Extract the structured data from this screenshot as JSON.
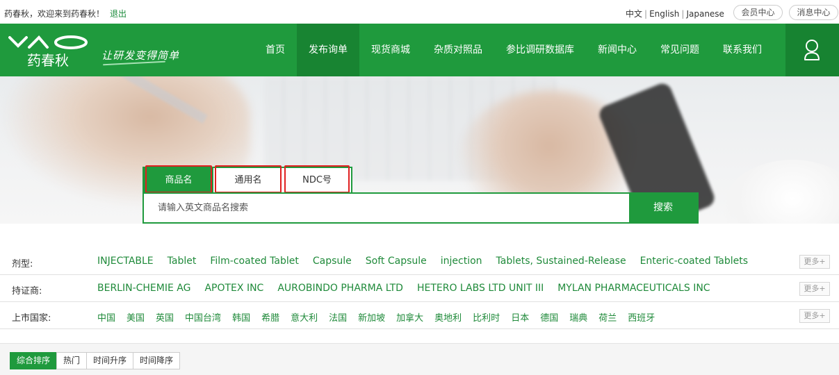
{
  "topbar": {
    "welcome": "药春秋，欢迎来到药春秋！",
    "logout": "退出",
    "languages": [
      "中文",
      "English",
      "Japanese"
    ],
    "member_center": "会员中心",
    "message_center": "消息中心"
  },
  "header": {
    "logo_text": "YAO",
    "logo_cn": "药春秋",
    "slogan": "让研发变得简单",
    "nav": [
      "首页",
      "发布询单",
      "现货商城",
      "杂质对照品",
      "参比调研数据库",
      "新闻中心",
      "常见问题",
      "联系我们"
    ],
    "active_nav": "发布询单"
  },
  "search": {
    "tabs": [
      "商品名",
      "通用名",
      "NDC号"
    ],
    "active_tab": "商品名",
    "placeholder": "请输入英文商品名搜索",
    "button": "搜索"
  },
  "filters": {
    "dosage": {
      "label": "剂型:",
      "values": [
        "INJECTABLE",
        "Tablet",
        "Film-coated Tablet",
        "Capsule",
        "Soft Capsule",
        "injection",
        "Tablets, Sustained-Release",
        "Enteric-coated Tablets"
      ],
      "more": "更多+"
    },
    "holder": {
      "label": "持证商:",
      "values": [
        "BERLIN-CHEMIE AG",
        "APOTEX INC",
        "AUROBINDO PHARMA LTD",
        "HETERO LABS LTD UNIT III",
        "MYLAN PHARMACEUTICALS INC"
      ],
      "more": "更多+"
    },
    "country": {
      "label": "上市国家:",
      "values": [
        "中国",
        "美国",
        "英国",
        "中国台湾",
        "韩国",
        "希腊",
        "意大利",
        "法国",
        "新加坡",
        "加拿大",
        "奥地利",
        "比利时",
        "日本",
        "德国",
        "瑞典",
        "荷兰",
        "西班牙"
      ],
      "more": "更多+"
    }
  },
  "sort": {
    "options": [
      "综合排序",
      "热门",
      "时间升序",
      "时间降序"
    ],
    "active": "综合排序"
  },
  "colors": {
    "brand_green": "#1f9a3d",
    "link_green": "#1f8a3a",
    "highlight_red": "#e02020"
  }
}
